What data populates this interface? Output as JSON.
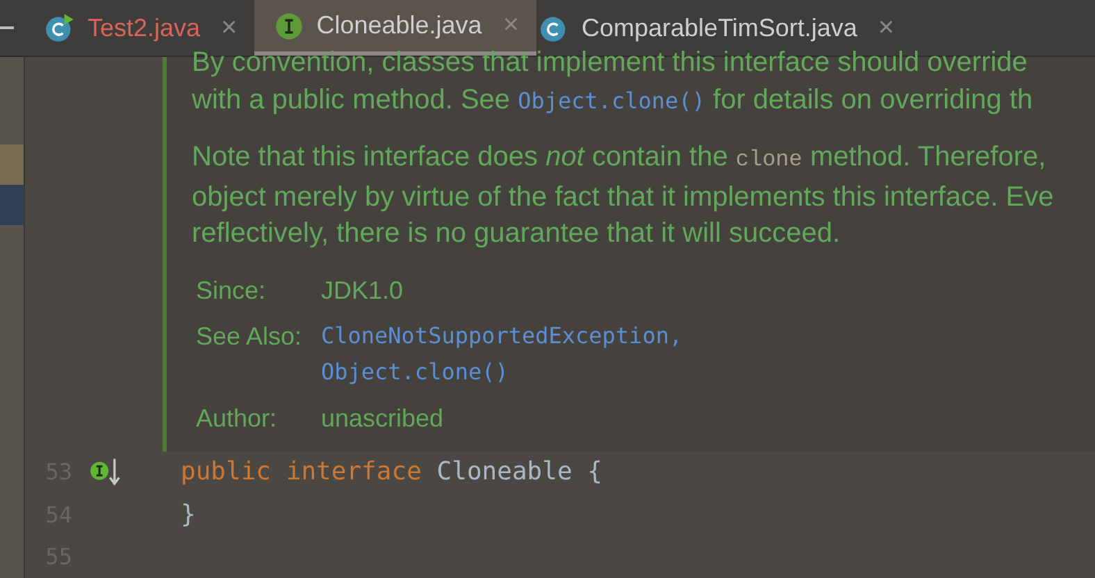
{
  "tabs": [
    {
      "label": "Test2.java",
      "kind": "runnable",
      "color": "#d8645a",
      "close": "×",
      "selected": false
    },
    {
      "label": "Cloneable.java",
      "kind": "interface",
      "color": "#cfcfcf",
      "close": "×",
      "selected": true
    },
    {
      "label": "ComparableTimSort.java",
      "kind": "class",
      "color": "#cfcfcf",
      "close": "×",
      "selected": false
    }
  ],
  "doc": {
    "paragraphs": [
      {
        "lines": [
          [
            {
              "kind": "text",
              "text": "By convention, classes that implement this interface should override"
            }
          ],
          [
            {
              "kind": "text",
              "text": "with a public method. See "
            },
            {
              "kind": "link",
              "text": "Object.clone()"
            },
            {
              "kind": "text",
              "text": " for details on overriding th"
            }
          ]
        ]
      },
      {
        "lines": [
          [
            {
              "kind": "text",
              "text": "Note that this interface does "
            },
            {
              "kind": "em",
              "text": "not"
            },
            {
              "kind": "text",
              "text": " contain the "
            },
            {
              "kind": "code",
              "text": "clone"
            },
            {
              "kind": "text",
              "text": " method. Therefore,"
            }
          ],
          [
            {
              "kind": "text",
              "text": "object merely by virtue of the fact that it implements this interface. Eve"
            }
          ],
          [
            {
              "kind": "text",
              "text": "reflectively, there is no guarantee that it will succeed."
            }
          ]
        ]
      }
    ],
    "tags": [
      {
        "label": "Since:",
        "values": [
          {
            "kind": "text",
            "text": "JDK1.0"
          }
        ]
      },
      {
        "label": "See Also:",
        "values": [
          {
            "kind": "link",
            "text": "CloneNotSupportedException,"
          },
          {
            "kind": "link",
            "text": "Object.clone()"
          }
        ]
      },
      {
        "label": "Author:",
        "values": [
          {
            "kind": "text",
            "text": "unascribed"
          }
        ]
      }
    ]
  },
  "code_lines": [
    {
      "number": "53",
      "kind": "marked",
      "tokens": [
        {
          "kind": "keyword",
          "text": "public"
        },
        {
          "kind": "keyword",
          "text": "interface"
        },
        {
          "kind": "name",
          "text": "Cloneable"
        },
        {
          "kind": "punct",
          "text": "{"
        }
      ]
    },
    {
      "number": "54",
      "kind": "plain",
      "tokens": [
        {
          "kind": "punct",
          "text": "}"
        }
      ]
    },
    {
      "number": "55",
      "kind": "plain"
    }
  ]
}
